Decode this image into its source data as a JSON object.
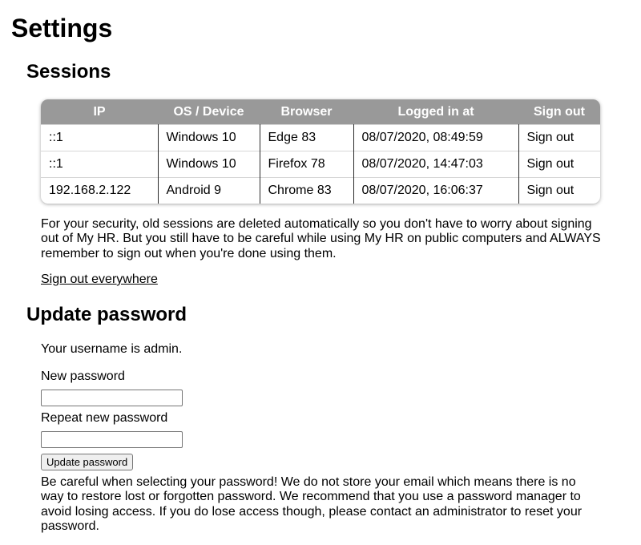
{
  "page": {
    "title": "Settings"
  },
  "sessions": {
    "title": "Sessions",
    "headers": [
      "IP",
      "OS / Device",
      "Browser",
      "Logged in at",
      "Sign out"
    ],
    "rows": [
      {
        "ip": "::1",
        "os": "Windows 10",
        "browser": "Edge 83",
        "logged_in": "08/07/2020, 08:49:59",
        "sign_out": "Sign out"
      },
      {
        "ip": "::1",
        "os": "Windows 10",
        "browser": "Firefox 78",
        "logged_in": "08/07/2020, 14:47:03",
        "sign_out": "Sign out"
      },
      {
        "ip": "192.168.2.122",
        "os": "Android 9",
        "browser": "Chrome 83",
        "logged_in": "08/07/2020, 16:06:37",
        "sign_out": "Sign out"
      }
    ],
    "note": "For your security, old sessions are deleted automatically so you don't have to worry about signing out of My HR. But you still have to be careful while using My HR on public computers and ALWAYS remember to sign out when you're done using them.",
    "sign_out_everywhere": "Sign out everywhere"
  },
  "password": {
    "title": "Update password",
    "username_line": "Your username is admin.",
    "new_label": "New password",
    "new_value": "",
    "repeat_label": "Repeat new password",
    "repeat_value": "",
    "button_label": "Update password",
    "note": "Be careful when selecting your password! We do not store your email which means there is no way to restore lost or forgotten password. We recommend that you use a password manager to avoid losing access. If you do lose access though, please contact an administrator to reset your password."
  }
}
